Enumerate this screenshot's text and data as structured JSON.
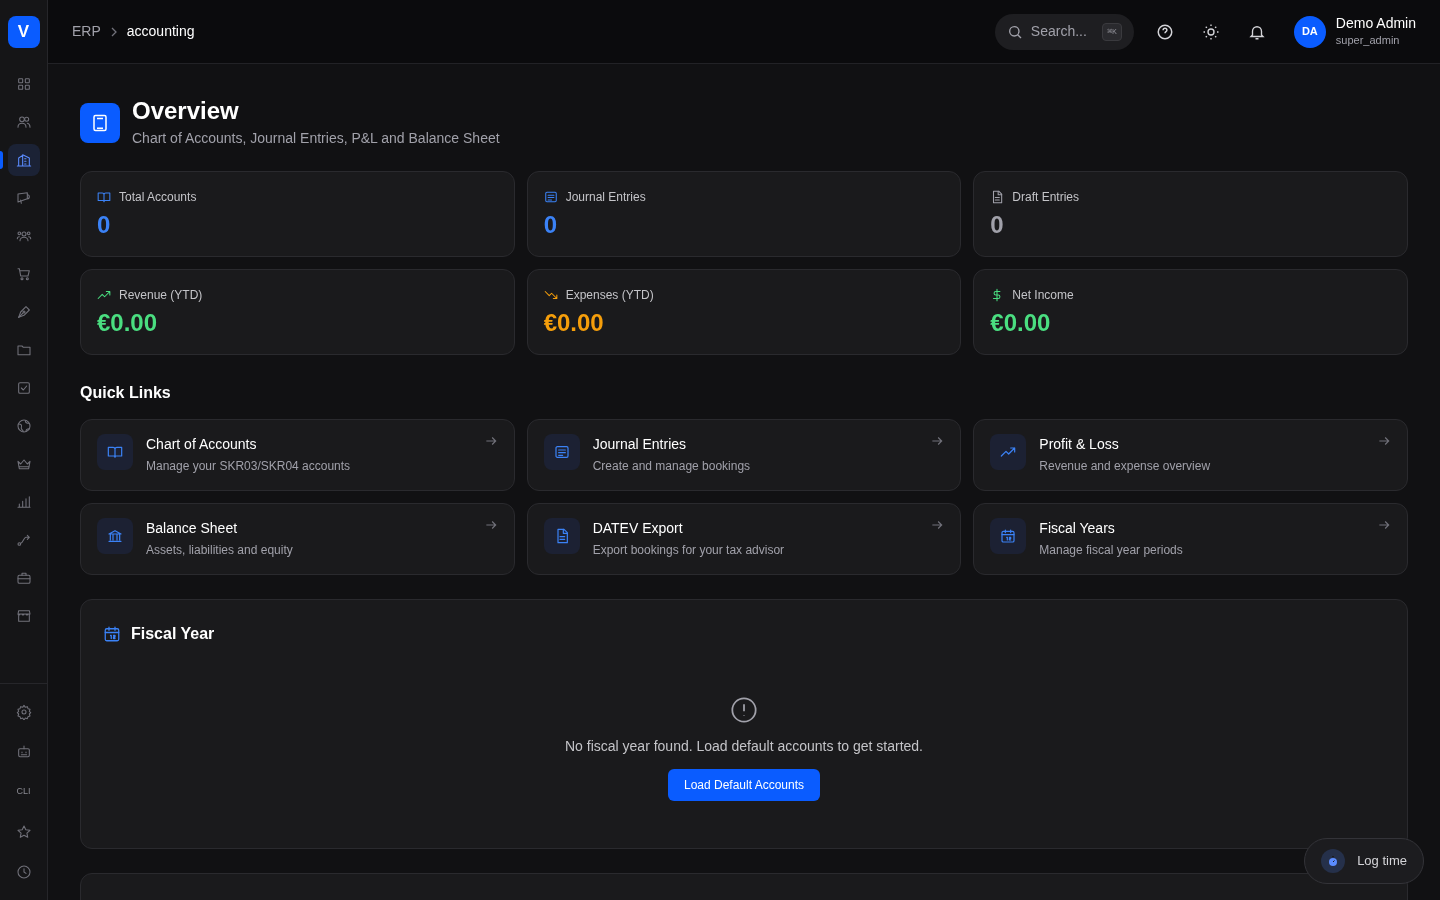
{
  "sidebar": {
    "logo": "V",
    "items": [
      {
        "kind": "grid",
        "selected": false
      },
      {
        "kind": "users",
        "selected": false
      },
      {
        "kind": "building",
        "selected": true
      },
      {
        "kind": "megaphone",
        "selected": false
      },
      {
        "kind": "team",
        "selected": false
      },
      {
        "kind": "cart",
        "selected": false
      },
      {
        "kind": "pen",
        "selected": false
      },
      {
        "kind": "folder",
        "selected": false
      },
      {
        "kind": "checkbox",
        "selected": false
      },
      {
        "kind": "globe",
        "selected": false
      },
      {
        "kind": "crown",
        "selected": false
      },
      {
        "kind": "chart",
        "selected": false
      },
      {
        "kind": "route",
        "selected": false
      },
      {
        "kind": "briefcase",
        "selected": false
      },
      {
        "kind": "store",
        "selected": false
      }
    ],
    "bottom_items": [
      {
        "kind": "gear"
      },
      {
        "kind": "robot"
      },
      {
        "kind": "text",
        "label": "CLI"
      },
      {
        "kind": "star"
      },
      {
        "kind": "clock"
      }
    ]
  },
  "breadcrumb": [
    "ERP",
    "accounting"
  ],
  "search": {
    "placeholder": "Search...",
    "shortcut": "⌘K"
  },
  "user": {
    "initials": "DA",
    "name": "Demo Admin",
    "role": "super_admin"
  },
  "page": {
    "title": "Overview",
    "subtitle": "Chart of Accounts, Journal Entries, P&L and Balance Sheet"
  },
  "stats": [
    {
      "kind": "book",
      "label": "Total Accounts",
      "value": "0",
      "color": "#3b82f6"
    },
    {
      "kind": "list",
      "label": "Journal Entries",
      "value": "0",
      "color": "#3b82f6"
    },
    {
      "kind": "doc",
      "label": "Draft Entries",
      "value": "0",
      "color": "#a1a1aa"
    },
    {
      "kind": "up",
      "label": "Revenue (YTD)",
      "value": "€0.00",
      "color": "#4ade80"
    },
    {
      "kind": "down",
      "label": "Expenses (YTD)",
      "value": "€0.00",
      "color": "#f59e0b"
    },
    {
      "kind": "dollar",
      "label": "Net Income",
      "value": "€0.00",
      "color": "#4ade80"
    }
  ],
  "quick_links": {
    "title": "Quick Links",
    "items": [
      {
        "kind": "book",
        "title": "Chart of Accounts",
        "description": "Manage your SKR03/SKR04 accounts"
      },
      {
        "kind": "list",
        "title": "Journal Entries",
        "description": "Create and manage bookings"
      },
      {
        "kind": "up",
        "title": "Profit & Loss",
        "description": "Revenue and expense overview"
      },
      {
        "kind": "bank",
        "title": "Balance Sheet",
        "description": "Assets, liabilities and equity"
      },
      {
        "kind": "doc",
        "title": "DATEV Export",
        "description": "Export bookings for your tax advisor"
      },
      {
        "kind": "calendar",
        "title": "Fiscal Years",
        "description": "Manage fiscal year periods"
      }
    ]
  },
  "fiscal_year": {
    "title": "Fiscal Year",
    "message": "No fiscal year found. Load default accounts to get started.",
    "button": "Load Default Accounts"
  },
  "log_time": {
    "label": "Log time"
  }
}
